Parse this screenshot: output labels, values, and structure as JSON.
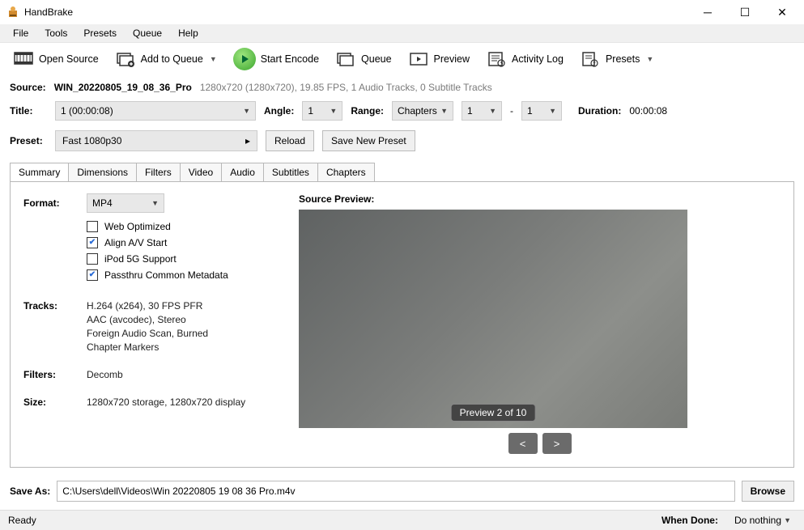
{
  "app": {
    "title": "HandBrake"
  },
  "menus": [
    "File",
    "Tools",
    "Presets",
    "Queue",
    "Help"
  ],
  "toolbar": {
    "open_source": "Open Source",
    "add_to_queue": "Add to Queue",
    "start_encode": "Start Encode",
    "queue": "Queue",
    "preview": "Preview",
    "activity_log": "Activity Log",
    "presets": "Presets"
  },
  "source": {
    "label": "Source:",
    "name": "WIN_20220805_19_08_36_Pro",
    "details": "1280x720 (1280x720), 19.85 FPS, 1 Audio Tracks, 0 Subtitle Tracks"
  },
  "title_row": {
    "title_label": "Title:",
    "title_value": "1  (00:00:08)",
    "angle_label": "Angle:",
    "angle_value": "1",
    "range_label": "Range:",
    "range_type": "Chapters",
    "range_from": "1",
    "range_dash": "-",
    "range_to": "1",
    "duration_label": "Duration:",
    "duration_value": "00:00:08"
  },
  "preset_row": {
    "label": "Preset:",
    "value": "Fast 1080p30",
    "reload": "Reload",
    "save_new": "Save New Preset"
  },
  "tabs": [
    "Summary",
    "Dimensions",
    "Filters",
    "Video",
    "Audio",
    "Subtitles",
    "Chapters"
  ],
  "summary": {
    "format_label": "Format:",
    "format_value": "MP4",
    "checks": {
      "web_opt": "Web Optimized",
      "align_av": "Align A/V Start",
      "ipod": "iPod 5G Support",
      "passthru": "Passthru Common Metadata"
    },
    "tracks_label": "Tracks:",
    "tracks": [
      "H.264 (x264), 30 FPS PFR",
      "AAC (avcodec), Stereo",
      "Foreign Audio Scan, Burned",
      "Chapter Markers"
    ],
    "filters_label": "Filters:",
    "filters_value": "Decomb",
    "size_label": "Size:",
    "size_value": "1280x720 storage, 1280x720 display"
  },
  "preview": {
    "title": "Source Preview:",
    "badge": "Preview 2 of 10",
    "prev": "<",
    "next": ">"
  },
  "saveas": {
    "label": "Save As:",
    "value": "C:\\Users\\dell\\Videos\\Win 20220805 19 08 36 Pro.m4v",
    "browse": "Browse"
  },
  "status": {
    "ready": "Ready",
    "when_done_label": "When Done:",
    "when_done_value": "Do nothing"
  }
}
